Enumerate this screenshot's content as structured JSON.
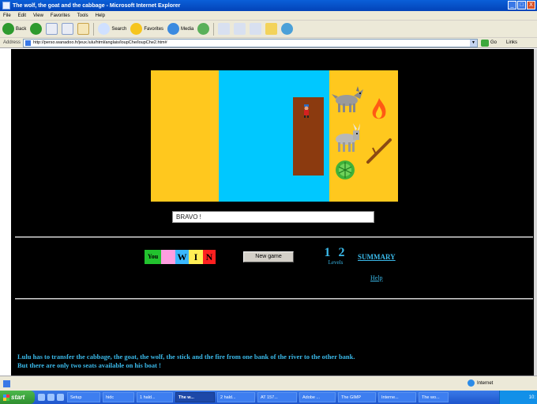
{
  "window": {
    "title": "The wolf, the goat and the cabbage - Microsoft Internet Explorer",
    "controls": [
      "_",
      "□",
      "X"
    ]
  },
  "menu": [
    "File",
    "Edit",
    "View",
    "Favorites",
    "Tools",
    "Help"
  ],
  "toolbar": {
    "back": "Back",
    "search": "Search",
    "favorites": "Favorites",
    "media": "Media"
  },
  "address": {
    "label": "Address",
    "url": "http://perso.wanadoo.fr/jeux.lulu/html/anglais/loupChe/loupChe2.htm#",
    "go": "Go",
    "links": "Links"
  },
  "game": {
    "message": "BRAVO !",
    "win_letters": [
      "You",
      "",
      "W",
      "I",
      "N"
    ],
    "new_game": "New game",
    "levels_numbers": "1 2",
    "levels_label": "Levels",
    "summary": "SUMMARY",
    "help": "Help",
    "description_line1": "Lulu has to transfer the cabbage, the goat, the wolf, the stick and the fire from one bank of the river to the other bank.",
    "description_line2": "But there are only two seats available on his boat !"
  },
  "colors": {
    "bank": "#ffc81e",
    "river": "#00c8ff",
    "boat": "#8b3a0f",
    "link": "#3ab8e8"
  },
  "status": {
    "zone": "Internet"
  },
  "taskbar": {
    "start": "start",
    "tasks": [
      "Setup",
      "hidc",
      "1 hald...",
      "The w...",
      "2 hald...",
      "AT 157...",
      "Adobe ...",
      "The GIMP",
      "Interne...",
      "The wo..."
    ],
    "clock": "10:"
  }
}
